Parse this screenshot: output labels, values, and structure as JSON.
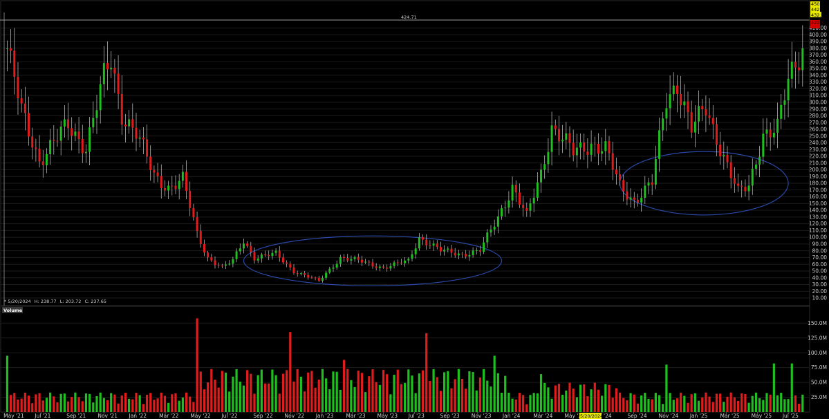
{
  "header": {
    "crosshair_value": "424.71"
  },
  "ohlc_readout": {
    "marker": "*",
    "date": "5/20/2024",
    "h_label": "H:",
    "h": "238.77",
    "l_label": "L:",
    "l": "203.72",
    "c_label": "C:",
    "c": "237.65"
  },
  "price_tags": {
    "top": "450.0",
    "yellow_1": "442.2",
    "yellow_2": "432.37",
    "red_1": "422.5",
    "red_2": "416.8"
  },
  "volume_panel": {
    "title": "Volume"
  },
  "x_cursor_label": "5/20/2024",
  "colors": {
    "up": "#1fbf1f",
    "down": "#e01c1c",
    "ellipse": "#2a49a8",
    "tag_yellow": "#e8e800",
    "tag_red": "#d40000",
    "crosshair": "#9a9a9a",
    "panel_bg": "#000000"
  },
  "chart_data": [
    {
      "type": "candlestick",
      "title": "",
      "x_tick_labels": [
        "May '21",
        "Jul '21",
        "Sep '21",
        "Nov '21",
        "Jan '22",
        "Mar '22",
        "May '22",
        "Jul '22",
        "Sep '22",
        "Nov '22",
        "Jan '23",
        "Mar '23",
        "May '23",
        "Jul '23",
        "Sep '23",
        "Nov '23",
        "Jan '24",
        "Mar '24",
        "May '24",
        "Jul '24",
        "Sep '24",
        "Nov '24",
        "Jan '25",
        "Mar '25",
        "May '25",
        "Jul '25"
      ],
      "y_ticks": [
        450,
        440,
        430,
        410,
        400,
        390,
        380,
        370,
        360,
        350,
        340,
        330,
        320,
        310,
        300,
        290,
        280,
        270,
        260,
        250,
        240,
        230,
        220,
        210,
        200,
        190,
        180,
        170,
        160,
        150,
        140,
        130,
        120,
        110,
        100,
        90,
        80,
        70,
        60,
        50,
        40,
        30,
        20,
        10
      ],
      "y_tick_labels": [
        "450.0",
        "440.0",
        "430.0",
        "410.00",
        "400.00",
        "390.00",
        "380.00",
        "370.00",
        "360.00",
        "350.00",
        "340.00",
        "330.00",
        "320.00",
        "310.00",
        "300.00",
        "290.00",
        "280.00",
        "270.00",
        "260.00",
        "250.00",
        "240.00",
        "230.00",
        "220.00",
        "210.00",
        "200.00",
        "190.00",
        "180.00",
        "170.00",
        "160.00",
        "150.00",
        "140.00",
        "130.00",
        "120.00",
        "110.00",
        "100.00",
        "90.00",
        "80.00",
        "70.00",
        "60.00",
        "50.00",
        "40.00",
        "30.00",
        "20.00",
        "10.00"
      ],
      "ylim": [
        0,
        455
      ],
      "anchors": [
        {
          "d": "2021-04-26",
          "p": 380
        },
        {
          "d": "2021-05-24",
          "p": 285
        },
        {
          "d": "2021-06-28",
          "p": 215
        },
        {
          "d": "2021-07-26",
          "p": 240
        },
        {
          "d": "2021-08-23",
          "p": 265
        },
        {
          "d": "2021-09-27",
          "p": 235
        },
        {
          "d": "2021-11-01",
          "p": 335
        },
        {
          "d": "2021-11-15",
          "p": 360
        },
        {
          "d": "2021-12-06",
          "p": 285
        },
        {
          "d": "2022-01-03",
          "p": 255
        },
        {
          "d": "2022-02-07",
          "p": 190
        },
        {
          "d": "2022-03-07",
          "p": 175
        },
        {
          "d": "2022-04-04",
          "p": 185
        },
        {
          "d": "2022-05-02",
          "p": 105
        },
        {
          "d": "2022-05-23",
          "p": 70
        },
        {
          "d": "2022-06-20",
          "p": 55
        },
        {
          "d": "2022-07-11",
          "p": 65
        },
        {
          "d": "2022-08-01",
          "p": 95
        },
        {
          "d": "2022-08-22",
          "p": 70
        },
        {
          "d": "2022-10-03",
          "p": 75
        },
        {
          "d": "2022-11-07",
          "p": 50
        },
        {
          "d": "2022-12-26",
          "p": 35
        },
        {
          "d": "2023-02-06",
          "p": 70
        },
        {
          "d": "2023-03-13",
          "p": 65
        },
        {
          "d": "2023-05-01",
          "p": 55
        },
        {
          "d": "2023-06-19",
          "p": 65
        },
        {
          "d": "2023-07-10",
          "p": 100
        },
        {
          "d": "2023-08-21",
          "p": 80
        },
        {
          "d": "2023-10-02",
          "p": 75
        },
        {
          "d": "2023-11-06",
          "p": 80
        },
        {
          "d": "2023-12-11",
          "p": 130
        },
        {
          "d": "2024-01-08",
          "p": 175
        },
        {
          "d": "2024-02-05",
          "p": 130
        },
        {
          "d": "2024-03-04",
          "p": 195
        },
        {
          "d": "2024-03-25",
          "p": 265
        },
        {
          "d": "2024-05-06",
          "p": 225
        },
        {
          "d": "2024-06-10",
          "p": 240
        },
        {
          "d": "2024-07-08",
          "p": 230
        },
        {
          "d": "2024-08-05",
          "p": 175
        },
        {
          "d": "2024-09-02",
          "p": 155
        },
        {
          "d": "2024-10-07",
          "p": 180
        },
        {
          "d": "2024-11-04",
          "p": 305
        },
        {
          "d": "2024-11-25",
          "p": 330
        },
        {
          "d": "2024-12-23",
          "p": 260
        },
        {
          "d": "2025-01-20",
          "p": 290
        },
        {
          "d": "2025-02-17",
          "p": 235
        },
        {
          "d": "2025-03-24",
          "p": 165
        },
        {
          "d": "2025-04-14",
          "p": 175
        },
        {
          "d": "2025-05-12",
          "p": 255
        },
        {
          "d": "2025-06-09",
          "p": 260
        },
        {
          "d": "2025-06-30",
          "p": 330
        },
        {
          "d": "2025-07-28",
          "p": 385
        }
      ],
      "annotations": [
        {
          "shape": "ellipse",
          "from": "2022-08-01",
          "to": "2023-12-18",
          "y_center": 65,
          "y_half_height": 37
        },
        {
          "shape": "ellipse",
          "from": "2024-08-05",
          "to": "2025-06-30",
          "y_center": 180,
          "y_half_height": 47
        }
      ]
    },
    {
      "type": "bar",
      "title": "Volume",
      "y_ticks": [
        25000000,
        50000000,
        75000000,
        100000000,
        125000000,
        150000000
      ],
      "y_tick_labels": [
        "25.0M",
        "50.0M",
        "75.0M",
        "100.0M",
        "125.0M",
        "150.0M"
      ],
      "ylim": [
        0,
        162000000
      ],
      "volume_peaks": [
        {
          "d": "2021-04-26",
          "v": 95000000
        },
        {
          "d": "2022-05-02",
          "v": 158000000
        },
        {
          "d": "2022-05-23",
          "v": 50000000
        },
        {
          "d": "2022-10-31",
          "v": 135000000
        },
        {
          "d": "2023-02-13",
          "v": 88000000
        },
        {
          "d": "2023-07-24",
          "v": 133000000
        },
        {
          "d": "2023-12-04",
          "v": 95000000
        },
        {
          "d": "2024-03-04",
          "v": 64000000
        },
        {
          "d": "2024-11-04",
          "v": 80000000
        },
        {
          "d": "2025-06-02",
          "v": 82000000
        },
        {
          "d": "2025-07-07",
          "v": 82000000
        }
      ],
      "volume_base": 22000000
    }
  ]
}
